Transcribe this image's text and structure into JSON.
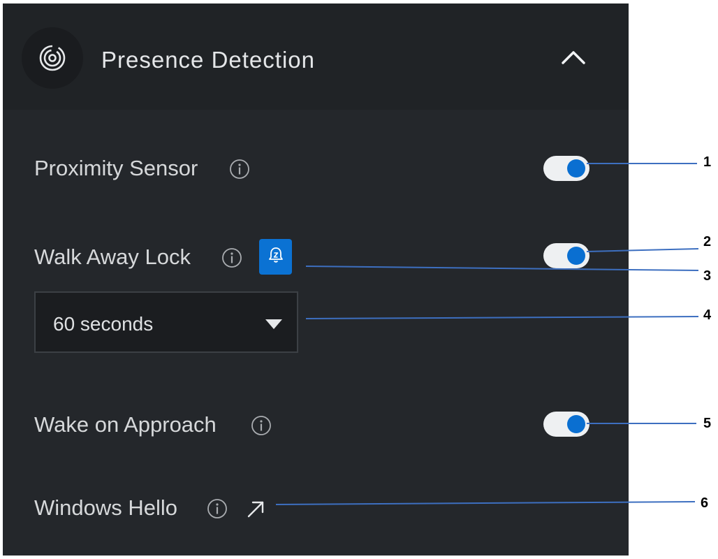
{
  "header": {
    "title": "Presence Detection",
    "icon": "presence-radar-icon",
    "collapse_icon": "chevron-up-icon"
  },
  "settings": {
    "proximity_sensor": {
      "label": "Proximity Sensor",
      "enabled": true
    },
    "walk_away_lock": {
      "label": "Walk Away Lock",
      "enabled": true,
      "snooze_icon": "bell-snooze-icon",
      "timeout": {
        "selected": "60 seconds"
      }
    },
    "wake_on_approach": {
      "label": "Wake on Approach",
      "enabled": true
    },
    "windows_hello": {
      "label": "Windows Hello",
      "link_icon": "external-link-arrow-icon"
    }
  },
  "callouts": [
    "1",
    "2",
    "3",
    "4",
    "5",
    "6"
  ],
  "colors": {
    "panel_bg": "#24272b",
    "header_bg": "#202326",
    "accent": "#0a6fd1",
    "toggle_track": "#eef0f2",
    "callout_line": "#3d6fc0"
  }
}
